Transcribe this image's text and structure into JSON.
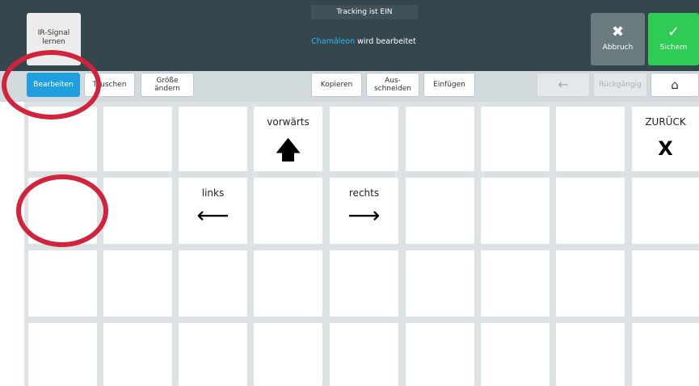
{
  "topbar": {
    "tracking_status": "Tracking ist EIN",
    "editing_name": "Chamäleon",
    "editing_suffix": " wird bearbeitet",
    "ir_button": {
      "line1": "IR-Signal",
      "line2": "lernen"
    },
    "cancel_button": {
      "icon": "✖",
      "label": "Abbruch"
    },
    "save_button": {
      "icon": "✓",
      "label": "Sichern"
    }
  },
  "toolbar": {
    "edit": "Bearbeiten",
    "swap": "Tauschen",
    "resize": {
      "line1": "Größe",
      "line2": "ändern"
    },
    "copy": "Kopieren",
    "cut": {
      "line1": "Aus-",
      "line2": "schneiden"
    },
    "paste": "Einfügen",
    "back_icon": "←",
    "undo": "Rückgängig",
    "home_icon": "⌂"
  },
  "grid": {
    "cells": {
      "forward": {
        "label": "vorwärts",
        "symbol": "🡅"
      },
      "back": {
        "label": "ZURÜCK",
        "symbol": "X"
      },
      "left": {
        "label": "links",
        "symbol": "⟵"
      },
      "right": {
        "label": "rechts",
        "symbol": "⟶"
      }
    }
  },
  "colors": {
    "topbar_bg": "#34474d",
    "accent_blue": "#1f9fe0",
    "save_green": "#2ecc55",
    "annotation_red": "#d1243c"
  }
}
